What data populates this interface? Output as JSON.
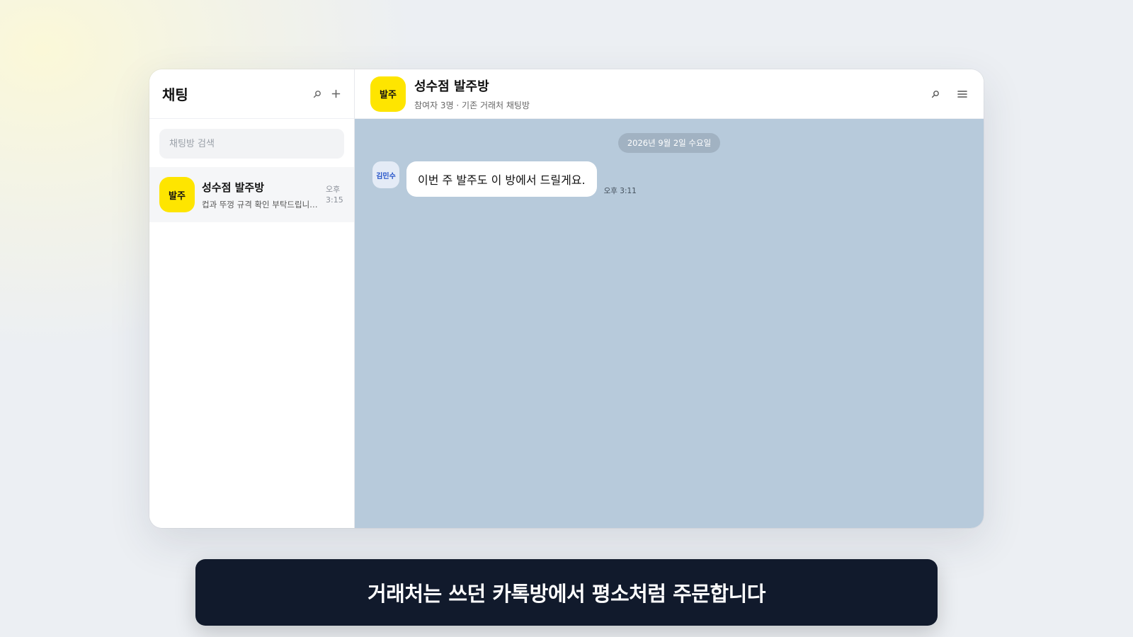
{
  "sidebar": {
    "title": "채팅",
    "search_placeholder": "채팅방 검색",
    "rooms": [
      {
        "avatar_label": "발주",
        "name": "성수점 발주방",
        "preview": "컵과 뚜껑 규격 확인 부탁드립니다.",
        "time_period": "오후",
        "time": "3:15"
      }
    ]
  },
  "chat": {
    "avatar_label": "발주",
    "title": "성수점 발주방",
    "subtitle": "참여자 3명 · 기존 거래처 채팅방",
    "date_divider": "2026년 9월 2일 수요일",
    "messages": [
      {
        "sender": "김민수",
        "text": "이번 주 발주도 이 방에서 드릴게요.",
        "time": "오후 3:11"
      }
    ]
  },
  "caption": "거래처는 쓰던 카톡방에서 평소처럼 주문합니다",
  "colors": {
    "accent_yellow": "#fee500",
    "chat_background": "#b7cadb",
    "caption_background": "#111a2c"
  },
  "icons": {
    "search": "search-icon",
    "add": "plus-icon",
    "menu": "hamburger-menu-icon"
  }
}
